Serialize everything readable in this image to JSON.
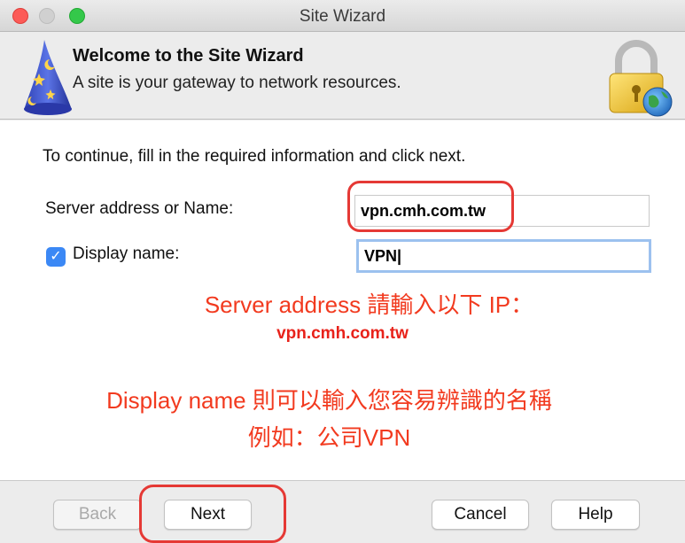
{
  "window": {
    "title": "Site Wizard"
  },
  "header": {
    "title": "Welcome to the Site Wizard",
    "subtitle": "A site is your gateway to network resources."
  },
  "form": {
    "instructions": "To continue, fill in the required information and click next.",
    "server_label": "Server address or Name:",
    "server_value": "vpn.cmh.com.tw",
    "display_checked": true,
    "display_label": "Display name:",
    "display_value": "VPN|"
  },
  "annotations": {
    "line1": "Server address 請輸入以下 IP：",
    "line2": "vpn.cmh.com.tw",
    "line3": "Display name 則可以輸入您容易辨識的名稱",
    "line4": "例如：公司VPN"
  },
  "footer": {
    "back_label": "Back",
    "next_label": "Next",
    "cancel_label": "Cancel",
    "help_label": "Help"
  },
  "colors": {
    "annotation_red": "#f23a1f",
    "checkbox_blue": "#3b88f5",
    "focus_ring": "#9cc1ef"
  },
  "icons": {
    "wizard": "wizard-hat-icon",
    "lock": "padlock-globe-icon",
    "check": "checkmark-icon"
  }
}
